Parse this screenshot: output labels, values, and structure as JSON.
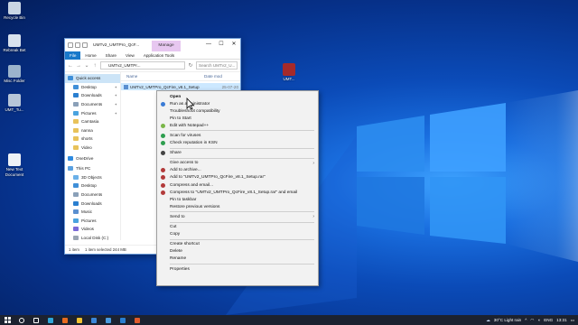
{
  "desktop": {
    "icons": [
      {
        "label": "Recycle Bin"
      },
      {
        "label": "Rebreak Bet"
      },
      {
        "label": "Misc Folder"
      },
      {
        "label": "UMT_Tu..."
      },
      {
        "label": "New Text Document"
      },
      {
        "label": "UMT..."
      }
    ]
  },
  "explorer": {
    "title": "UMTv2_UMTPro_QcF...",
    "manage_label": "Manage",
    "controls": {
      "minimize": "—",
      "maximize": "☐",
      "close": "✕"
    },
    "ribbon_tabs": [
      "File",
      "Home",
      "Share",
      "View",
      "Application Tools"
    ],
    "address": "UMTv2_UMTPr...",
    "search_placeholder": "Search UMTv2_U...",
    "nav_items": [
      {
        "label": "Quick access",
        "color": "#3f8fd8"
      },
      {
        "label": "Desktop",
        "color": "#3f8fd8"
      },
      {
        "label": "Downloads",
        "color": "#2a7fd0"
      },
      {
        "label": "Documents",
        "color": "#8aa0b8"
      },
      {
        "label": "Pictures",
        "color": "#4aa3df"
      },
      {
        "label": "Camtasia",
        "color": "#e8c25a"
      },
      {
        "label": "nanna",
        "color": "#e8c25a"
      },
      {
        "label": "shorts",
        "color": "#e8c25a"
      },
      {
        "label": "Video",
        "color": "#e8c25a"
      },
      {
        "label": "OneDrive",
        "color": "#2f8be0"
      },
      {
        "label": "This PC",
        "color": "#5aa0e0"
      },
      {
        "label": "3D Objects",
        "color": "#6ab0e8"
      },
      {
        "label": "Desktop",
        "color": "#3f8fd8"
      },
      {
        "label": "Documents",
        "color": "#8aa0b8"
      },
      {
        "label": "Downloads",
        "color": "#2a7fd0"
      },
      {
        "label": "Music",
        "color": "#5a8fd0"
      },
      {
        "label": "Pictures",
        "color": "#4aa3df"
      },
      {
        "label": "Videos",
        "color": "#7a6ad8"
      },
      {
        "label": "Local Disk (C:)",
        "color": "#9aa5b3"
      }
    ],
    "columns": {
      "name": "Name",
      "date": "Date mod"
    },
    "file": {
      "name": "UMTv2_UMTPro_QcFire_v8.1_Setup",
      "date": "25-07-20"
    },
    "status": {
      "count": "1 item",
      "selected": "1 item selected  244 MB"
    }
  },
  "context_menu": {
    "items": [
      {
        "label": "Open",
        "bold": true,
        "icon": null,
        "sep_after": false,
        "arrow": false
      },
      {
        "label": "Run as administrator",
        "icon": "shield-icon",
        "color": "#3a7bd5",
        "sep_after": false,
        "arrow": false
      },
      {
        "label": "Troubleshoot compatibility",
        "icon": null,
        "sep_after": false,
        "arrow": false
      },
      {
        "label": "Pin to Start",
        "icon": null,
        "sep_after": false,
        "arrow": false
      },
      {
        "label": "Edit with Notepad++",
        "icon": "notepad-icon",
        "color": "#7ab648",
        "sep_after": true,
        "arrow": false
      },
      {
        "label": "Scan for viruses",
        "icon": "antivirus-icon",
        "color": "#2e9e4f",
        "sep_after": false,
        "arrow": false
      },
      {
        "label": "Check reputation in KSN",
        "icon": "ksn-icon",
        "color": "#2e9e4f",
        "sep_after": true,
        "arrow": false
      },
      {
        "label": "Share",
        "icon": "share-icon",
        "color": "#444444",
        "sep_after": true,
        "arrow": false
      },
      {
        "label": "Give access to",
        "icon": null,
        "sep_after": false,
        "arrow": true
      },
      {
        "label": "Add to archive...",
        "icon": "archive-icon",
        "color": "#b23a3a",
        "sep_after": false,
        "arrow": false
      },
      {
        "label": "Add to \"UMTv2_UMTPro_QcFire_v8.1_Setup.rar\"",
        "icon": "archive-icon",
        "color": "#b23a3a",
        "sep_after": false,
        "arrow": false
      },
      {
        "label": "Compress and email...",
        "icon": "archive-icon",
        "color": "#b23a3a",
        "sep_after": false,
        "arrow": false
      },
      {
        "label": "Compress to \"UMTv2_UMTPro_QcFire_v8.1_Setup.rar\" and email",
        "icon": "archive-icon",
        "color": "#b23a3a",
        "sep_after": false,
        "arrow": false
      },
      {
        "label": "Pin to taskbar",
        "icon": null,
        "sep_after": false,
        "arrow": false
      },
      {
        "label": "Restore previous versions",
        "icon": null,
        "sep_after": true,
        "arrow": false
      },
      {
        "label": "Send to",
        "icon": null,
        "sep_after": true,
        "arrow": true
      },
      {
        "label": "Cut",
        "icon": null,
        "sep_after": false,
        "arrow": false
      },
      {
        "label": "Copy",
        "icon": null,
        "sep_after": true,
        "arrow": false
      },
      {
        "label": "Create shortcut",
        "icon": null,
        "sep_after": false,
        "arrow": false
      },
      {
        "label": "Delete",
        "icon": null,
        "sep_after": false,
        "arrow": false
      },
      {
        "label": "Rename",
        "icon": null,
        "sep_after": true,
        "arrow": false
      },
      {
        "label": "Properties",
        "icon": null,
        "sep_after": false,
        "arrow": false
      }
    ]
  },
  "taskbar": {
    "start_icon": "windows-logo-icon",
    "apps": [
      {
        "name": "search-icon",
        "color": "#ffffff"
      },
      {
        "name": "task-view-icon",
        "color": "#ffffff"
      },
      {
        "name": "edge-icon",
        "color": "#2fa6d9"
      },
      {
        "name": "firefox-icon",
        "color": "#e76a1e"
      },
      {
        "name": "file-explorer-icon",
        "color": "#f1c232"
      },
      {
        "name": "photos-icon",
        "color": "#3a86d8"
      },
      {
        "name": "store-icon",
        "color": "#4a9be0"
      },
      {
        "name": "mail-icon",
        "color": "#2a7fd0"
      },
      {
        "name": "app-icon",
        "color": "#e05a2b"
      }
    ],
    "weather": "30°C  Light rain",
    "language": "ENG",
    "time": "13:31"
  }
}
